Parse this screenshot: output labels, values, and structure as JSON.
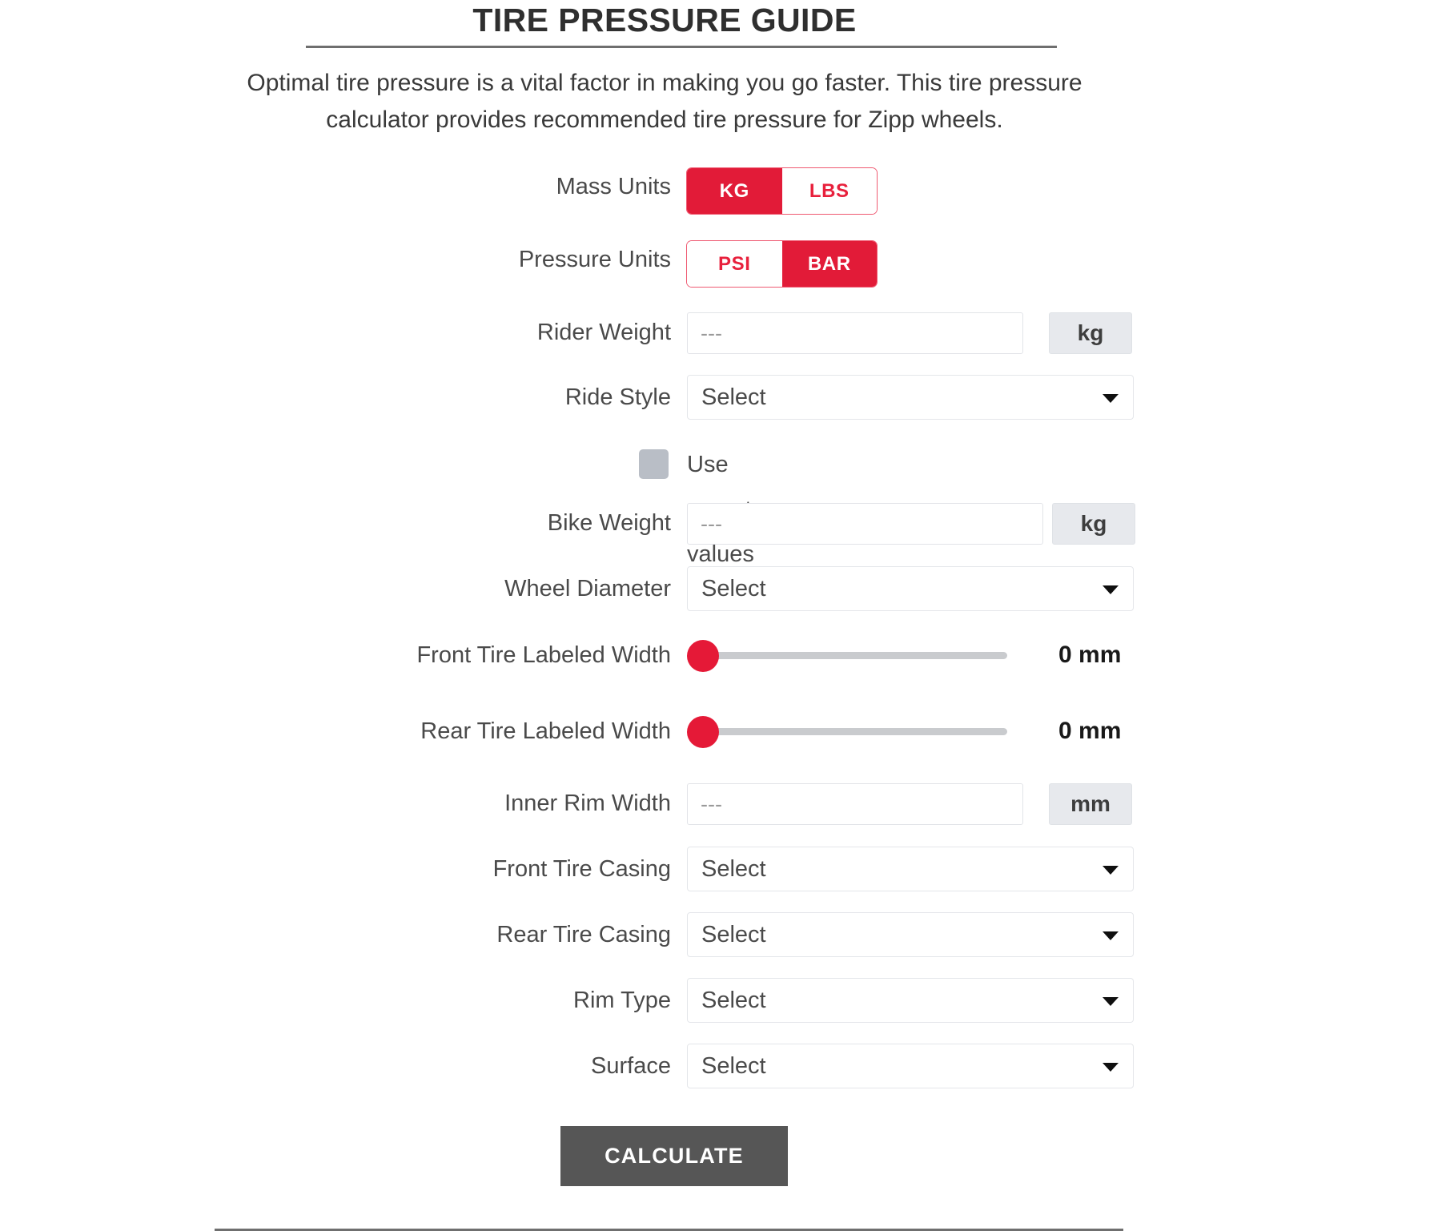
{
  "header": {
    "title": "TIRE PRESSURE GUIDE",
    "intro_line1": "Optimal tire pressure is a vital factor in making you go faster. This tire pressure",
    "intro_line2": "calculator provides recommended tire pressure for Zipp wheels."
  },
  "colors": {
    "accent_red": "#e21b38",
    "accent_red_border": "#ef5a72",
    "button_gray": "#565656",
    "suffix_gray": "#e7e9ed",
    "checkbox_gray": "#b9bec6",
    "slider_track": "#c9cbce",
    "slider_thumb": "#e51937",
    "rule_gray": "#6f6f6f"
  },
  "form": {
    "mass_units": {
      "label": "Mass Units",
      "options": [
        "KG",
        "LBS"
      ],
      "selected": "KG"
    },
    "pressure_units": {
      "label": "Pressure Units",
      "options": [
        "PSI",
        "BAR"
      ],
      "selected": "BAR"
    },
    "rider_weight": {
      "label": "Rider Weight",
      "value": "",
      "placeholder": "---",
      "unit": "kg"
    },
    "ride_style": {
      "label": "Ride Style",
      "selected": "Select"
    },
    "use_preset": {
      "label": "Use preset values",
      "checked": false
    },
    "bike_weight": {
      "label": "Bike Weight",
      "value": "",
      "placeholder": "---",
      "unit": "kg"
    },
    "wheel_diameter": {
      "label": "Wheel Diameter",
      "selected": "Select"
    },
    "front_tire_width": {
      "label": "Front Tire Labeled Width",
      "value": 0,
      "value_display": "0 mm",
      "min": 0,
      "max": 100,
      "unit": "mm"
    },
    "rear_tire_width": {
      "label": "Rear Tire Labeled Width",
      "value": 0,
      "value_display": "0 mm",
      "min": 0,
      "max": 100,
      "unit": "mm"
    },
    "inner_rim_width": {
      "label": "Inner Rim Width",
      "value": "",
      "placeholder": "---",
      "unit": "mm"
    },
    "front_tire_casing": {
      "label": "Front Tire Casing",
      "selected": "Select"
    },
    "rear_tire_casing": {
      "label": "Rear Tire Casing",
      "selected": "Select"
    },
    "rim_type": {
      "label": "Rim Type",
      "selected": "Select"
    },
    "surface": {
      "label": "Surface",
      "selected": "Select"
    }
  },
  "actions": {
    "calculate": "CALCULATE"
  }
}
